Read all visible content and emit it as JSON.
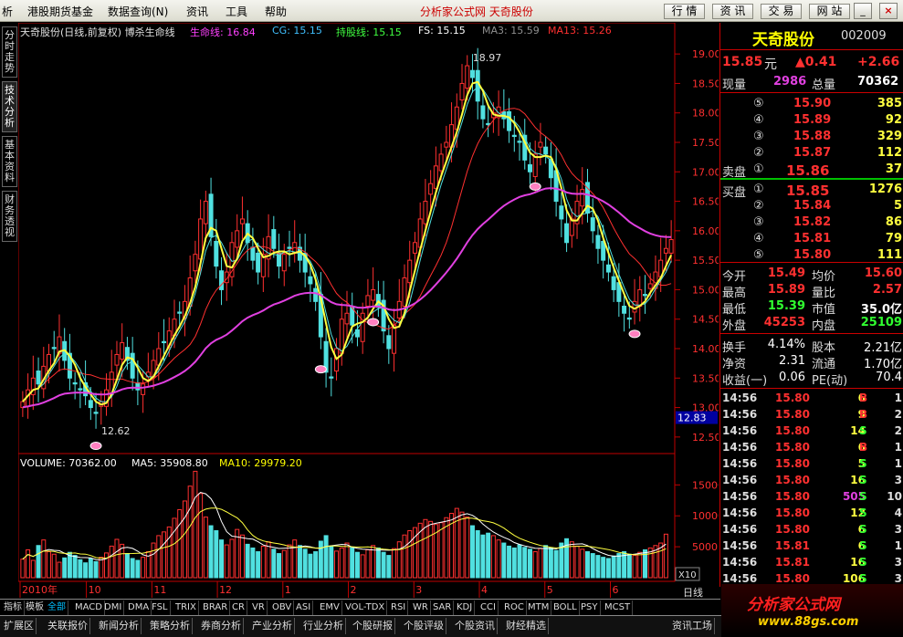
{
  "menubar": {
    "items": [
      "析",
      "港股期货基金",
      "数据查询(N)",
      "资讯",
      "工具",
      "帮助"
    ],
    "site_title": "分析家公式网  天奇股份",
    "buttons": [
      "行 情",
      "资 讯",
      "交 易",
      "网 站"
    ],
    "win_controls": [
      "_",
      "□",
      "×"
    ]
  },
  "left_tabs": [
    "分时走势",
    "技术分析",
    "基本资料",
    "财务透视"
  ],
  "chart_legend": {
    "title": "天奇股份(日线,前复权) 博杀生命线",
    "items": [
      {
        "label": "生命线: 16.84",
        "color": "#ff40ff"
      },
      {
        "label": "CG: 15.15",
        "color": "#40c0ff"
      },
      {
        "label": "持股线: 15.15",
        "color": "#40ff40"
      },
      {
        "label": "FS: 15.15",
        "color": "#ffffff"
      },
      {
        "label": "MA3: 15.59",
        "color": "#909090"
      },
      {
        "label": "MA13: 15.26",
        "color": "#ff3030"
      }
    ]
  },
  "price_axis": [
    "19.00",
    "18.50",
    "18.00",
    "17.50",
    "17.00",
    "16.50",
    "16.00",
    "15.50",
    "15.00",
    "14.50",
    "14.00",
    "13.50",
    "13.00",
    "12.50"
  ],
  "price_marker": "12.83",
  "annotations": {
    "high": "18.97",
    "low": "12.62"
  },
  "volume_legend": [
    {
      "label": "VOLUME: 70362.00",
      "color": "#ffffff"
    },
    {
      "label": "MA5: 35908.80",
      "color": "#ffffff"
    },
    {
      "label": "MA10: 29979.20",
      "color": "#ffff00"
    }
  ],
  "volume_axis": [
    "15000",
    "10000",
    "5000"
  ],
  "volume_scale": "X10",
  "x_labels": [
    "2010年",
    "10",
    "11",
    "12",
    "1",
    "2",
    "3",
    "4",
    "5",
    "6"
  ],
  "chart_data": {
    "type": "candlestick",
    "y_range": [
      12.25,
      19.25
    ],
    "close": [
      13.1,
      13.3,
      13.5,
      13.4,
      13.7,
      13.9,
      14.0,
      14.2,
      13.8,
      13.5,
      13.4,
      13.3,
      13.2,
      13.0,
      12.9,
      13.1,
      13.3,
      13.6,
      13.9,
      14.1,
      13.8,
      13.5,
      13.3,
      13.4,
      13.6,
      13.8,
      14.0,
      14.1,
      14.3,
      14.5,
      14.6,
      14.8,
      15.2,
      15.6,
      16.2,
      16.5,
      15.9,
      15.4,
      15.0,
      15.3,
      15.8,
      16.0,
      16.2,
      15.8,
      15.5,
      15.3,
      15.6,
      15.9,
      15.7,
      15.4,
      15.6,
      15.7,
      15.8,
      15.5,
      15.3,
      15.1,
      14.8,
      14.2,
      13.6,
      13.5,
      14.0,
      14.5,
      14.6,
      14.4,
      14.2,
      14.6,
      14.9,
      15.0,
      14.7,
      14.3,
      14.0,
      14.4,
      14.8,
      15.2,
      15.5,
      15.8,
      16.2,
      16.5,
      16.8,
      17.1,
      17.3,
      17.5,
      17.8,
      18.1,
      18.5,
      18.8,
      18.6,
      18.2,
      17.9,
      17.8,
      18.0,
      18.1,
      17.9,
      17.7,
      17.6,
      17.5,
      17.2,
      17.0,
      17.3,
      17.5,
      17.3,
      16.9,
      16.5,
      16.2,
      15.8,
      16.2,
      16.5,
      16.7,
      16.3,
      16.0,
      15.7,
      15.5,
      15.3,
      15.0,
      14.8,
      14.6,
      14.5,
      14.8,
      15.0,
      14.9,
      15.1,
      15.3,
      15.5,
      15.7,
      15.85
    ],
    "series": [
      {
        "name": "生命线",
        "color": "#e040e0"
      },
      {
        "name": "持股线",
        "color": "#ffff40"
      },
      {
        "name": "MA13",
        "color": "#ff3030"
      }
    ],
    "volume": [
      3000,
      4500,
      2800,
      5200,
      6100,
      4200,
      3800,
      2500,
      3200,
      4100,
      3600,
      2900,
      2400,
      3100,
      2600,
      3300,
      4000,
      5100,
      6200,
      5400,
      3900,
      3100,
      2800,
      3300,
      4200,
      5600,
      6800,
      7400,
      8200,
      9600,
      11000,
      12400,
      14800,
      17200,
      13600,
      9800,
      8400,
      7600,
      6100,
      5300,
      6200,
      7800,
      6900,
      5400,
      4800,
      4200,
      5100,
      5800,
      4600,
      3900,
      4400,
      5300,
      6100,
      5200,
      4600,
      3800,
      4200,
      5900,
      6800,
      5100,
      4300,
      4800,
      5600,
      4900,
      4100,
      3700,
      4500,
      5200,
      4800,
      4100,
      3600,
      4700,
      5800,
      6900,
      7600,
      8100,
      8800,
      9400,
      9100,
      8600,
      8900,
      9700,
      10400,
      11200,
      10600,
      9800,
      8400,
      7600,
      6900,
      7200,
      6800,
      6100,
      5600,
      5100,
      4800,
      5300,
      4900,
      4600,
      4200,
      4700,
      5200,
      4800,
      4400,
      5600,
      6300,
      5800,
      5100,
      4600,
      4200,
      3900,
      3600,
      3300,
      3100,
      3500,
      3900,
      4200,
      3800,
      3600,
      4100,
      4500,
      4800,
      5200,
      5600,
      7036
    ]
  },
  "quote": {
    "name": "天奇股份",
    "code": "002009",
    "price": "15.85",
    "price_unit": "元",
    "change": "▲0.41",
    "change_pct": "+2.66",
    "cur_vol_label": "现量",
    "cur_vol": "2986",
    "total_vol_label": "总量",
    "total_vol": "70362",
    "sell": [
      {
        "lv": "⑤",
        "p": "15.90",
        "v": "385"
      },
      {
        "lv": "④",
        "p": "15.89",
        "v": "92"
      },
      {
        "lv": "③",
        "p": "15.88",
        "v": "329"
      },
      {
        "lv": "②",
        "p": "15.87",
        "v": "112"
      },
      {
        "lv": "①",
        "p": "15.86",
        "v": "37",
        "label": "卖盘"
      }
    ],
    "buy": [
      {
        "lv": "①",
        "p": "15.85",
        "v": "1276",
        "label": "买盘"
      },
      {
        "lv": "②",
        "p": "15.84",
        "v": "5"
      },
      {
        "lv": "③",
        "p": "15.82",
        "v": "86"
      },
      {
        "lv": "④",
        "p": "15.81",
        "v": "79"
      },
      {
        "lv": "⑤",
        "p": "15.80",
        "v": "111"
      }
    ],
    "stats": [
      {
        "l1": "今开",
        "v1": "15.49",
        "l2": "均价",
        "v2": "15.60",
        "c1": "#ff3030",
        "c2": "#ff3030"
      },
      {
        "l1": "最高",
        "v1": "15.89",
        "l2": "量比",
        "v2": "2.57",
        "c1": "#ff3030",
        "c2": "#ff3030"
      },
      {
        "l1": "最低",
        "v1": "15.39",
        "l2": "市值",
        "v2": "35.0亿",
        "c1": "#30ff30",
        "c2": "#ffffff"
      },
      {
        "l1": "外盘",
        "v1": "45253",
        "l2": "内盘",
        "v2": "25109",
        "c1": "#ff3030",
        "c2": "#30ff30"
      }
    ],
    "fund": [
      {
        "l1": "换手",
        "v1": "4.14%",
        "l2": "股本",
        "v2": "2.21亿"
      },
      {
        "l1": "净资",
        "v1": "2.31",
        "l2": "流通",
        "v2": "1.70亿"
      },
      {
        "l1": "收益(一)",
        "v1": "0.06",
        "l2": "PE(动)",
        "v2": "70.4"
      }
    ],
    "ticks": [
      {
        "t": "14:56",
        "p": "15.80",
        "v": "6",
        "bs": "B",
        "n": "1"
      },
      {
        "t": "14:56",
        "p": "15.80",
        "v": "9",
        "bs": "B",
        "n": "2"
      },
      {
        "t": "14:56",
        "p": "15.80",
        "v": "14",
        "bs": "S",
        "n": "2"
      },
      {
        "t": "14:56",
        "p": "15.80",
        "v": "6",
        "bs": "B",
        "n": "1"
      },
      {
        "t": "14:56",
        "p": "15.80",
        "v": "5",
        "bs": "S",
        "n": "1"
      },
      {
        "t": "14:56",
        "p": "15.80",
        "v": "16",
        "bs": "S",
        "n": "3"
      },
      {
        "t": "14:56",
        "p": "15.80",
        "v": "505",
        "bs": "S",
        "n": "10"
      },
      {
        "t": "14:56",
        "p": "15.80",
        "v": "12",
        "bs": "S",
        "n": "4"
      },
      {
        "t": "14:56",
        "p": "15.80",
        "v": "6",
        "bs": "S",
        "n": "3"
      },
      {
        "t": "14:56",
        "p": "15.81",
        "v": "6",
        "bs": "S",
        "n": "1"
      },
      {
        "t": "14:56",
        "p": "15.81",
        "v": "16",
        "bs": "S",
        "n": "3"
      },
      {
        "t": "14:56",
        "p": "15.80",
        "v": "106",
        "bs": "S",
        "n": "3"
      }
    ]
  },
  "indicator_tabs": [
    "指标",
    "模板",
    "全部",
    "MACD",
    "DMI",
    "DMA",
    "FSL",
    "TRIX",
    "BRAR",
    "CR",
    "VR",
    "OBV",
    "ASI",
    "EMV",
    "VOL-TDX",
    "RSI",
    "WR",
    "SAR",
    "KDJ",
    "CCI",
    "ROC",
    "MTM",
    "BOLL",
    "PSY",
    "MCST"
  ],
  "day_tab": "日线",
  "bottom_tabs": [
    "扩展区",
    "关联报价",
    "新闻分析",
    "策略分析",
    "券商分析",
    "产业分析",
    "行业分析",
    "个股研报",
    "个股评级",
    "个股资讯",
    "财经精选",
    "资讯工场"
  ],
  "logo": {
    "main": "分析家公式网",
    "url": "www.88gs.com"
  }
}
